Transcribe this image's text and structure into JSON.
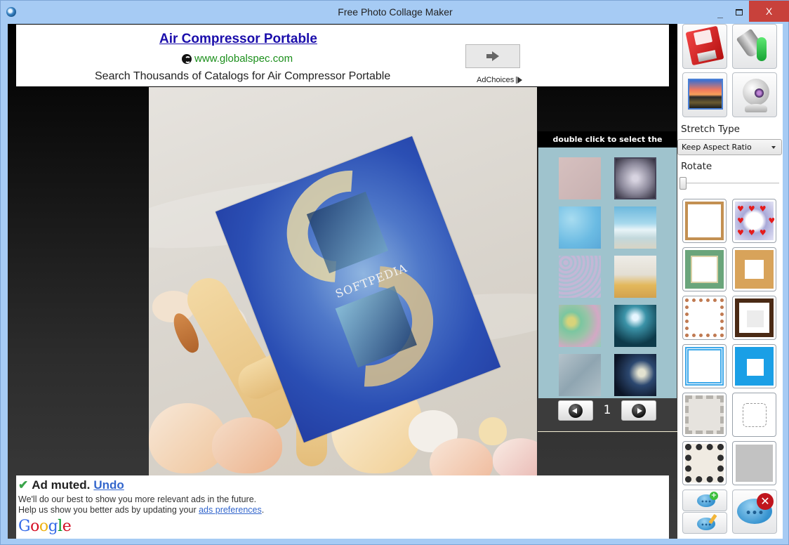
{
  "window": {
    "title": "Free Photo Collage Maker",
    "controls": {
      "minimize": "_",
      "close": "X"
    }
  },
  "ad_top": {
    "headline": "Air Compressor Portable",
    "url": "www.globalspec.com",
    "description": "Search Thousands of Catalogs for Air Compressor Portable",
    "adchoices_label": "AdChoices",
    "go_icon": "arrow-right-icon"
  },
  "canvas": {
    "background_image": "sand-and-seashells",
    "placed_photo": {
      "name": "softpedia-s-island",
      "caption": "SOFTPEDIA",
      "rotation_deg": -21
    }
  },
  "gallery": {
    "header": "double click to select the image.",
    "thumbnails": [
      {
        "name": "pink-texture"
      },
      {
        "name": "silver-ornament"
      },
      {
        "name": "blue-swirl"
      },
      {
        "name": "beach-sea"
      },
      {
        "name": "hexagon-pattern"
      },
      {
        "name": "sand-starfish"
      },
      {
        "name": "green-circles"
      },
      {
        "name": "moonlit-arch"
      },
      {
        "name": "silk-gray"
      },
      {
        "name": "night-moon"
      }
    ],
    "page": "1",
    "prev_icon": "prev-page-icon",
    "next_icon": "next-page-icon"
  },
  "ad_bottom": {
    "status": "Ad muted.",
    "undo_label": "Undo",
    "line1": "We'll do our best to show you more relevant ads in the future.",
    "line2_prefix": "Help us show you better ads by updating your ",
    "preferences_link": "ads preferences",
    "line2_suffix": ".",
    "brand": "Google"
  },
  "sidebar": {
    "tools": [
      {
        "name": "save",
        "icon": "floppy-heart-icon"
      },
      {
        "name": "background-color",
        "icon": "paint-bucket-icon"
      },
      {
        "name": "add-picture",
        "icon": "picture-icon"
      },
      {
        "name": "webcam",
        "icon": "webcam-icon"
      }
    ],
    "stretch_type_label": "Stretch Type",
    "stretch_type_value": "Keep Aspect Ratio",
    "rotate_label": "Rotate",
    "rotate_value": 0,
    "frames": [
      {
        "name": "wood-thin-frame"
      },
      {
        "name": "hearts-frame"
      },
      {
        "name": "green-mosaic-frame"
      },
      {
        "name": "golden-wood-frame"
      },
      {
        "name": "beaded-frame"
      },
      {
        "name": "dark-wood-frame"
      },
      {
        "name": "blue-stitched-frame"
      },
      {
        "name": "clouds-frame"
      },
      {
        "name": "stone-tile-frame"
      },
      {
        "name": "puzzle-outline-frame"
      },
      {
        "name": "checker-frame"
      },
      {
        "name": "gray-fill-frame"
      }
    ],
    "text_tools": [
      {
        "name": "add-text",
        "icon": "add-comment-icon"
      },
      {
        "name": "edit-text",
        "icon": "edit-comment-icon"
      },
      {
        "name": "delete-text",
        "icon": "delete-comment-icon"
      }
    ]
  },
  "colors": {
    "window_frame": "#a6cbf4",
    "close_button": "#c8413b",
    "ad_link": "#1a0dab",
    "ad_url": "#1b8f1b",
    "gallery_bg": "#9fc3cd",
    "google_link": "#3366cc"
  }
}
